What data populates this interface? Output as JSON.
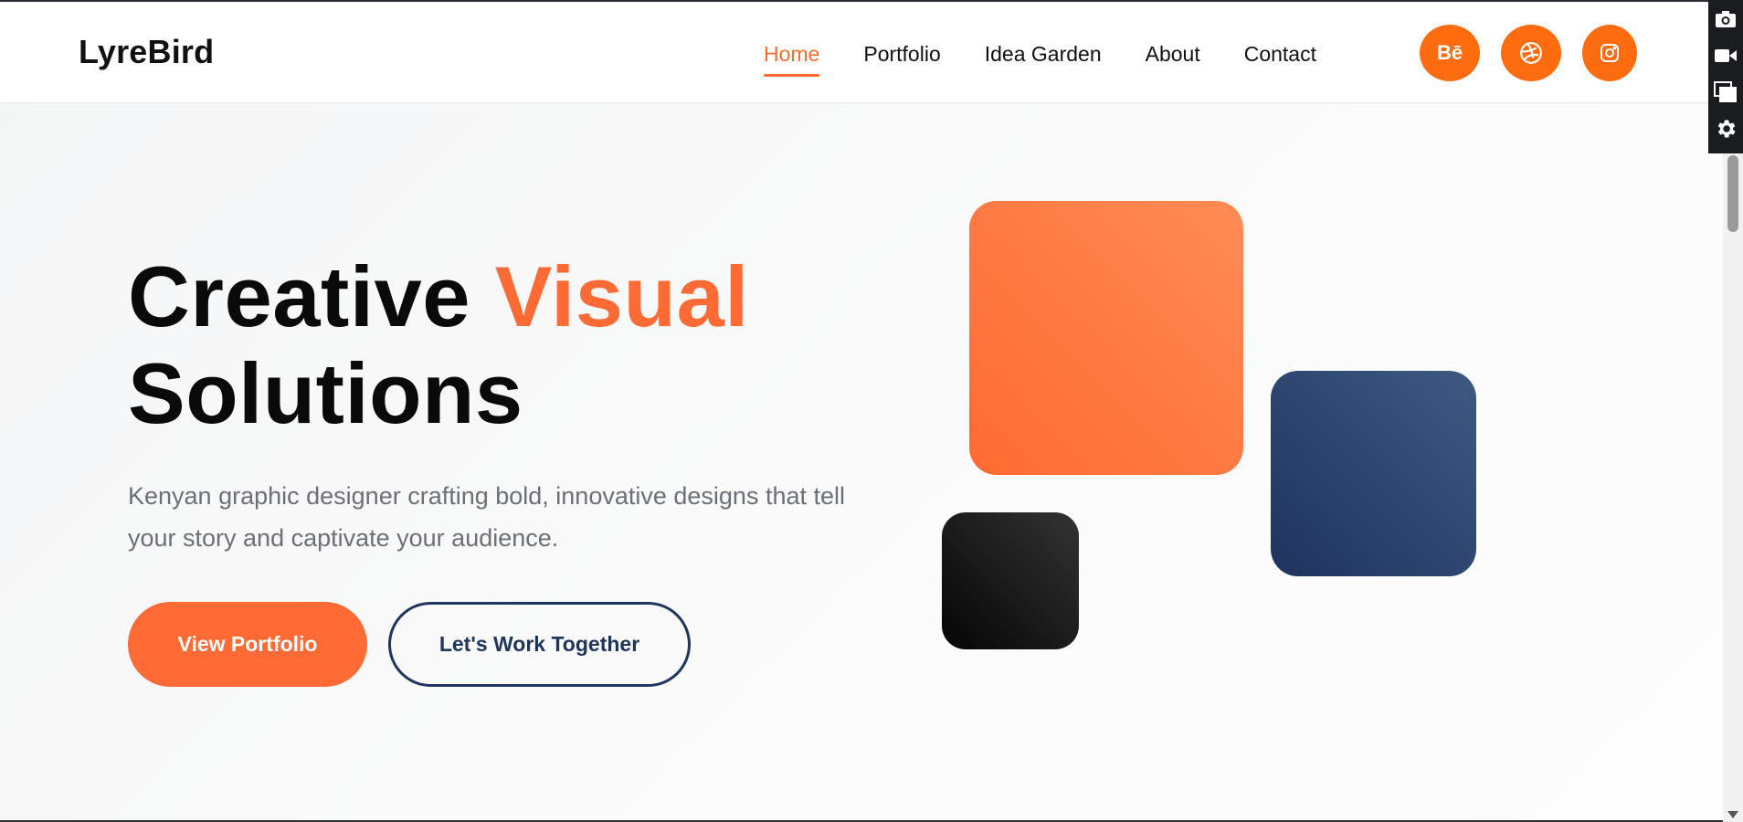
{
  "brand": {
    "logo": "LyreBird"
  },
  "nav": {
    "items": [
      {
        "label": "Home",
        "active": true
      },
      {
        "label": "Portfolio"
      },
      {
        "label": "Idea Garden"
      },
      {
        "label": "About"
      },
      {
        "label": "Contact"
      }
    ]
  },
  "socials": [
    {
      "label": "Bē",
      "icon": "behance-icon"
    },
    {
      "label": "",
      "icon": "dribbble-icon"
    },
    {
      "label": "",
      "icon": "instagram-icon"
    }
  ],
  "hero": {
    "title_part1": "Creative ",
    "title_accent": "Visual",
    "title_part2": "Solutions",
    "subtitle": "Kenyan graphic designer crafting bold, innovative designs that tell your story and captivate your audience.",
    "primary_button": "View Portfolio",
    "secondary_button": "Let's Work Together"
  },
  "colors": {
    "accent": "#ff6a35",
    "navy": "#1e3560",
    "dark": "#0a0a0a"
  },
  "toolbar": {
    "icons": [
      "camera-icon",
      "video-icon",
      "window-icon",
      "gear-icon"
    ]
  }
}
